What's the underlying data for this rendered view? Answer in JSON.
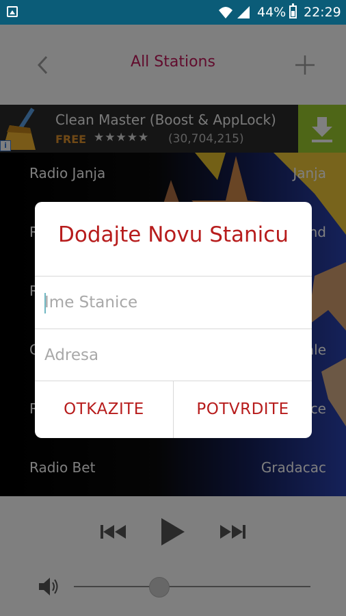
{
  "status_bar": {
    "battery": "44%",
    "time": "22:29",
    "icons": [
      "gallery-icon",
      "wifi-icon",
      "signal-icon",
      "battery-icon"
    ]
  },
  "header": {
    "title": "All Stations",
    "back_icon": "chevron-left-icon",
    "add_icon": "plus-icon",
    "title_color": "#c2185b"
  },
  "ad": {
    "title": "Clean Master (Boost & AppLock)",
    "price": "FREE",
    "rating_stars": "★★★★★",
    "reviews": "(30,704,215)",
    "download_icon": "download-icon",
    "info_icon": "info-icon"
  },
  "stations": [
    {
      "name": "Radio Janja",
      "city": "Janja"
    },
    {
      "name": "R",
      "city": "nd"
    },
    {
      "name": "R",
      "city": ""
    },
    {
      "name": "C",
      "city": "ale"
    },
    {
      "name": "R",
      "city": "ce"
    },
    {
      "name": "Radio Bet",
      "city": "Gradacac"
    }
  ],
  "player": {
    "rewind_icon": "rewind-icon",
    "play_icon": "play-icon",
    "forward_icon": "fast-forward-icon",
    "volume_icon": "volume-icon",
    "volume_level": 0.36
  },
  "dialog": {
    "title": "Dodajte Novu Stanicu",
    "name_placeholder": "Ime Stanice",
    "address_placeholder": "Adresa",
    "cancel_label": "OTKAZITE",
    "confirm_label": "POTVRDITE",
    "accent": "#b71c1c"
  }
}
